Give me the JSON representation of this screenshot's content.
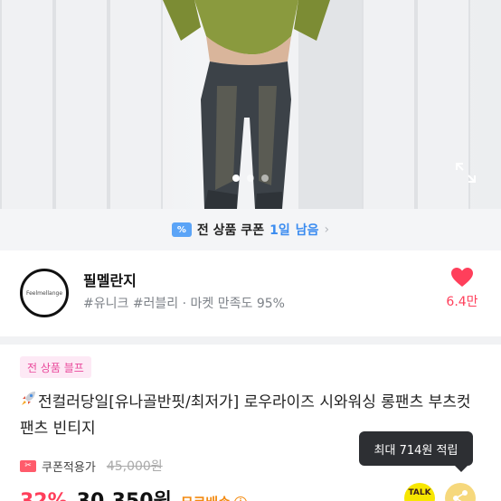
{
  "gallery": {
    "dot_count": 3,
    "active_index": 0,
    "colors": {
      "jeans": "#3c4248",
      "top": "#8a9a3e",
      "skin": "#d9b59b"
    }
  },
  "coupon_banner": {
    "ticket_icon": "coupon-ticket-icon",
    "prefix": "전 상품 쿠폰",
    "highlight": "1일",
    "suffix": "남음"
  },
  "store": {
    "logo_text": "Feelmellange",
    "name": "필멜란지",
    "tags": "#유니크 #러블리 · 마켓 만족도 95%",
    "like_count": "6.4만",
    "heart_color": "#ff3f5b"
  },
  "product": {
    "event_badge": "전 상품 블프",
    "title": "전컬러당일[유나골반핏/최저가] 로우라이즈 시와워싱 롱팬츠 부츠컷팬츠 빈티지",
    "coupon_price_label": "쿠폰적용가",
    "original_price": "45,000원",
    "discount": "32%",
    "price": "30,350원",
    "shipping": "무료배송",
    "info_icon": "i"
  },
  "tooltip": {
    "text": "최대 714원 적립"
  },
  "talk_button": {
    "label": "TALK"
  }
}
